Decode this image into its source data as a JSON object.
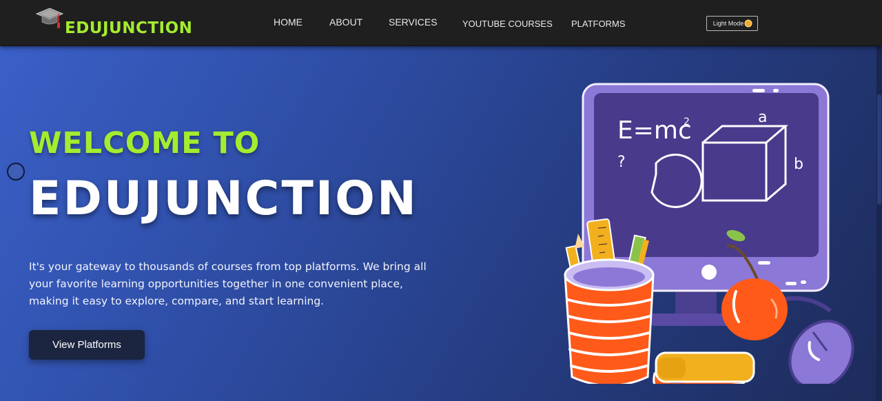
{
  "nav": {
    "brand": "EDUJUNCTION",
    "brand_icon": "graduation-cap-icon",
    "links": [
      "HOME",
      "ABOUT",
      "SERVICES",
      "YOUTUBE COURSES",
      "PLATFORMS"
    ],
    "theme_toggle": "Light Mode",
    "theme_icon": "sun-icon"
  },
  "hero": {
    "welcome": "WELCOME TO",
    "title": "EDUJUNCTION",
    "tagline": "It's your gateway to thousands of courses from top platforms. We bring all your favorite learning opportunities together in one convenient place, making it easy to explore, compare, and start learning.",
    "cta": "View Platforms",
    "board": {
      "formula": "E=mc",
      "exponent": "2",
      "question": "?",
      "label_a": "a",
      "label_b": "b"
    }
  },
  "colors": {
    "accent_green": "#a4ec2f",
    "navbar_bg": "#1f1f1f",
    "hero_gradient_start": "#3a5fc7",
    "hero_gradient_end": "#1d2b5a",
    "monitor_purple": "#8c78d6",
    "board_purple": "#4a3a8c",
    "apple_red": "#ff5a1a"
  }
}
